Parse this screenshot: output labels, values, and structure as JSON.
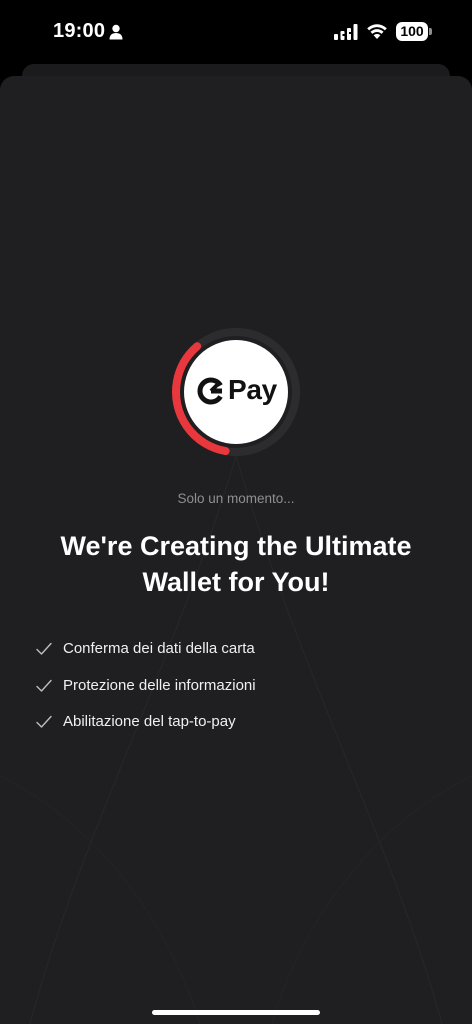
{
  "status_bar": {
    "time": "19:00",
    "battery": "100",
    "icons": [
      "person-icon",
      "signal-icon",
      "wifi-icon",
      "battery-icon"
    ]
  },
  "loader": {
    "progress": 0.36,
    "accent_color": "#e8383d",
    "track_color": "#2c2c2e",
    "logo_text": "Pay",
    "logo_icon": "curve-pay-logo-icon"
  },
  "content": {
    "subtitle": "Solo un momento...",
    "title": "We're Creating the Ultimate Wallet for You!",
    "steps": [
      {
        "label": "Conferma dei dati della carta",
        "icon": "check-icon"
      },
      {
        "label": "Protezione delle informazioni",
        "icon": "check-icon"
      },
      {
        "label": "Abilitazione del tap-to-pay",
        "icon": "check-icon"
      }
    ]
  },
  "colors": {
    "background": "#1f1f21",
    "text": "#ffffff",
    "muted_text": "#8f8f93"
  }
}
